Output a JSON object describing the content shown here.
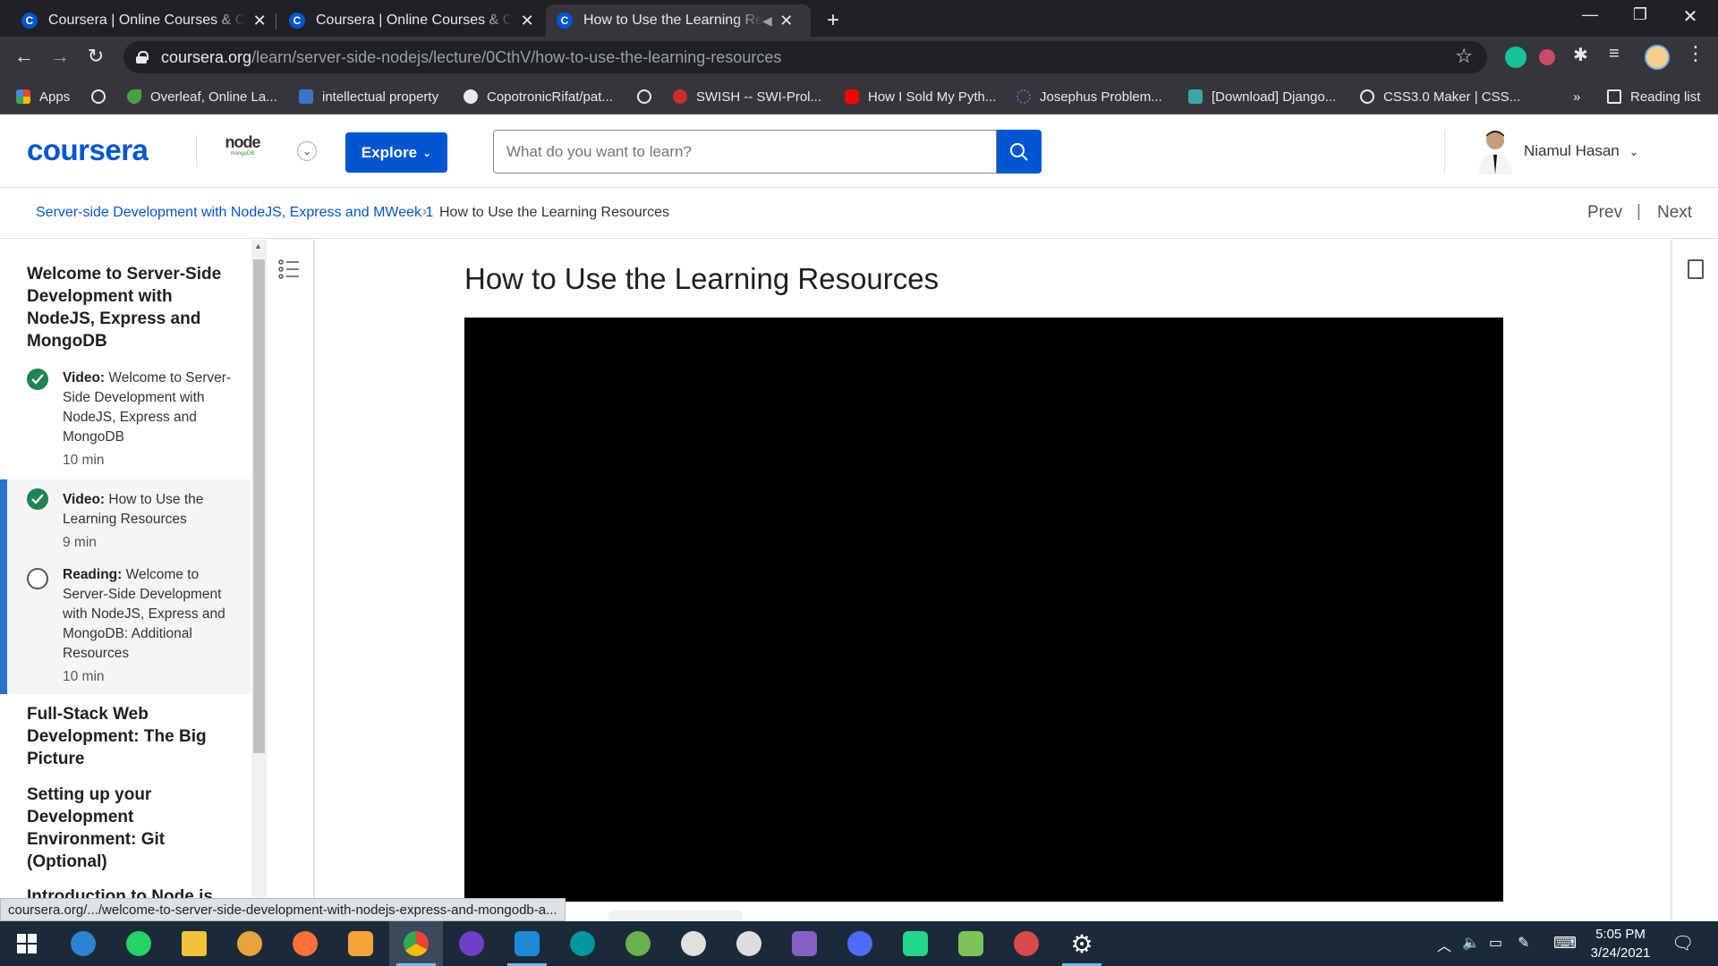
{
  "browser": {
    "tabs": [
      {
        "title": "Coursera | Online Courses & Credentials",
        "active": false
      },
      {
        "title": "Coursera | Online Courses & Credentials",
        "active": false
      },
      {
        "title": "How to Use the Learning Resources",
        "active": true
      }
    ],
    "url_host": "coursera.org",
    "url_path": "/learn/server-side-nodejs/lecture/0CthV/how-to-use-the-learning-resources",
    "bookmarks": [
      {
        "label": "Apps",
        "color": "#e8eaed"
      },
      {
        "label": "",
        "color": "#e8eaed"
      },
      {
        "label": "Overleaf, Online La...",
        "color": "#47a141"
      },
      {
        "label": "intellectual property",
        "color": "#3b76c4"
      },
      {
        "label": "CopotronicRifat/pat...",
        "color": "#e8eaed"
      },
      {
        "label": "",
        "color": "#e8eaed"
      },
      {
        "label": "SWISH -- SWI-Prol...",
        "color": "#c9302c"
      },
      {
        "label": "How I Sold My Pyth...",
        "color": "#ff0000"
      },
      {
        "label": "Josephus Problem...",
        "color": "#4f6ec8"
      },
      {
        "label": "[Download] Django...",
        "color": "#3aa7a7"
      },
      {
        "label": "CSS3.0 Maker | CSS...",
        "color": "#e8eaed"
      }
    ],
    "bookmarks_overflow": "»",
    "reading_list": "Reading list"
  },
  "header": {
    "logo": "coursera",
    "partner_logo_text": "node",
    "partner_logo_sub": "mongoDB",
    "explore_label": "Explore",
    "search_placeholder": "What do you want to learn?",
    "user_name": "Niamul Hasan"
  },
  "breadcrumb": {
    "course": "Server-side Development with NodeJS, Express and MWeek 1",
    "separator": "›",
    "current": "How to Use the Learning Resources",
    "prev": "Prev",
    "divider": "|",
    "next": "Next"
  },
  "sidebar": {
    "module1_title": "Welcome to Server-Side Development with NodeJS, Express and MongoDB",
    "items": [
      {
        "kind": "Video:",
        "title": "Welcome to Server-Side Development with NodeJS, Express and MongoDB",
        "duration": "10 min",
        "status": "done"
      },
      {
        "kind": "Video:",
        "title": "How to Use the Learning Resources",
        "duration": "9 min",
        "status": "done"
      },
      {
        "kind": "Reading:",
        "title": "Welcome to Server-Side Development with NodeJS, Express and MongoDB: Additional Resources",
        "duration": "10 min",
        "status": "reading"
      }
    ],
    "module2_title": "Full-Stack Web Development: The Big Picture",
    "module3_title": "Setting up your Development Environment: Git (Optional)",
    "module4_title": "Introduction to Node.js"
  },
  "main": {
    "lesson_title": "How to Use the Learning Resources"
  },
  "status_bar_url": "coursera.org/.../welcome-to-server-side-development-with-nodejs-express-and-mongodb-a...",
  "taskbar": {
    "time": "5:05 PM",
    "date": "3/24/2021",
    "apps": [
      {
        "name": "windows-start",
        "color": "#ffffff"
      },
      {
        "name": "edge-chromium",
        "color": "#2a84d2"
      },
      {
        "name": "whatsapp",
        "color": "#25d366"
      },
      {
        "name": "file-explorer",
        "color": "#f3c23b"
      },
      {
        "name": "privacy-app",
        "color": "#e8a33b"
      },
      {
        "name": "firefox",
        "color": "#ff7139"
      },
      {
        "name": "photo-app",
        "color": "#f7a23a"
      },
      {
        "name": "chrome",
        "color": "#4285f4"
      },
      {
        "name": "github-desktop",
        "color": "#6e40c9"
      },
      {
        "name": "vscode",
        "color": "#1e8ad6"
      },
      {
        "name": "arduino",
        "color": "#00979d"
      },
      {
        "name": "geogebra-earth",
        "color": "#6ab04c"
      },
      {
        "name": "dotnet-app",
        "color": "#e0e0e0"
      },
      {
        "name": "inkscape",
        "color": "#dddddd"
      },
      {
        "name": "visual-studio",
        "color": "#8661c5"
      },
      {
        "name": "messenger",
        "color": "#4a6cf7"
      },
      {
        "name": "pycharm",
        "color": "#21d789"
      },
      {
        "name": "notepad-app",
        "color": "#7cc35b"
      },
      {
        "name": "game-app",
        "color": "#d94a4a"
      },
      {
        "name": "settings",
        "color": "#ffffff"
      }
    ]
  },
  "colors": {
    "coursera_blue": "#0056d2",
    "done_green": "#1f8354",
    "active_bar": "#2a73cc"
  }
}
